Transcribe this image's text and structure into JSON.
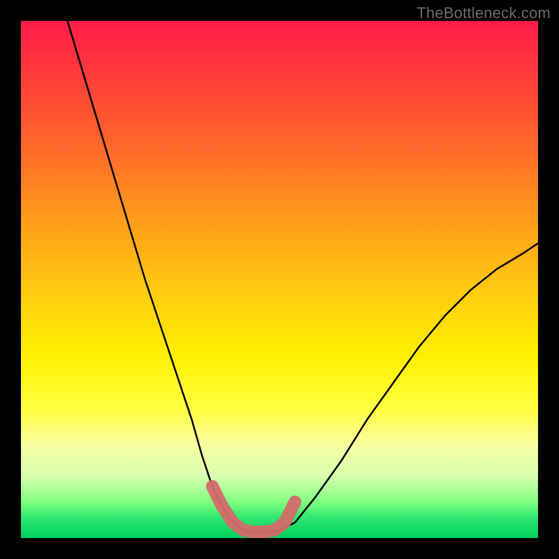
{
  "watermark": "TheBottleneck.com",
  "chart_data": {
    "type": "line",
    "title": "",
    "xlabel": "",
    "ylabel": "",
    "xlim": [
      0,
      100
    ],
    "ylim": [
      0,
      100
    ],
    "series": [
      {
        "name": "bottleneck-curve",
        "x": [
          9,
          12,
          15,
          18,
          21,
          24,
          27,
          30,
          33,
          35,
          37,
          39,
          41,
          43,
          45,
          48,
          50,
          53,
          57,
          62,
          67,
          72,
          77,
          82,
          87,
          92,
          97,
          100
        ],
        "y": [
          100,
          90,
          80,
          70,
          60,
          50,
          41,
          32,
          23,
          16,
          10,
          6,
          3,
          1.5,
          1.2,
          1.2,
          1.5,
          3,
          8,
          15,
          23,
          30,
          37,
          43,
          48,
          52,
          55,
          57
        ]
      }
    ],
    "highlight": {
      "name": "optimal-zone",
      "x": [
        37,
        39,
        41,
        43,
        45,
        47,
        49,
        51,
        53
      ],
      "y": [
        10,
        6,
        3,
        1.5,
        1.2,
        1.2,
        1.5,
        3,
        7
      ]
    },
    "colors": {
      "curve": "#000000",
      "highlight": "#d46a6a",
      "gradient_top": "#ff1a4a",
      "gradient_mid": "#fff000",
      "gradient_bottom": "#00d060",
      "frame": "#000000"
    }
  }
}
